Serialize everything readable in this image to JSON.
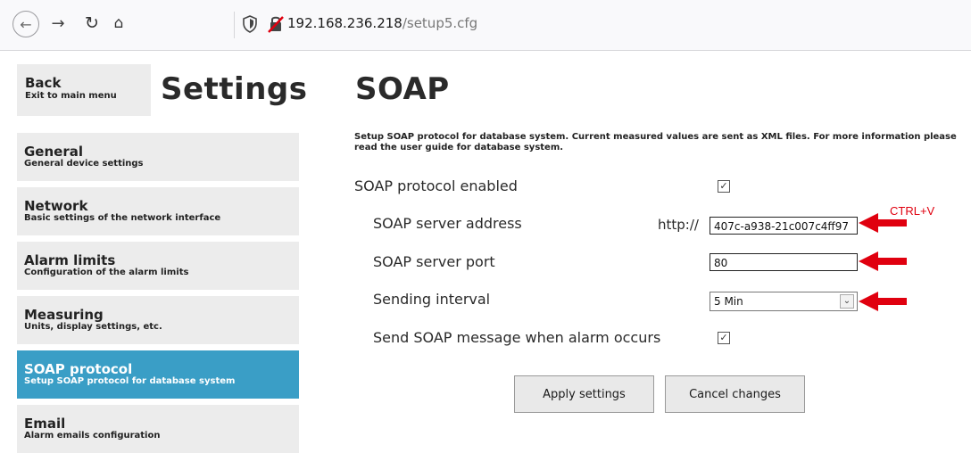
{
  "browser": {
    "url_host": "192.168.236.218",
    "url_path": "/setup5.cfg"
  },
  "sidebar": {
    "back": {
      "title": "Back",
      "subtitle": "Exit to main menu"
    },
    "heading": "Settings",
    "items": [
      {
        "title": "General",
        "subtitle": "General device settings"
      },
      {
        "title": "Network",
        "subtitle": "Basic settings of the network interface"
      },
      {
        "title": "Alarm limits",
        "subtitle": "Configuration of the alarm limits"
      },
      {
        "title": "Measuring",
        "subtitle": "Units, display settings, etc."
      },
      {
        "title": "SOAP protocol",
        "subtitle": "Setup SOAP protocol for database system"
      },
      {
        "title": "Email",
        "subtitle": "Alarm emails configuration"
      }
    ],
    "active_index": 4
  },
  "main": {
    "title": "SOAP",
    "description": "Setup SOAP protocol for database system. Current measured values are sent as XML files. For more information please read the user guide for database system.",
    "fields": {
      "enabled_label": "SOAP protocol enabled",
      "enabled_checked": true,
      "server_address_label": "SOAP server address",
      "server_address_prefix": "http://",
      "server_address_value": "407c-a938-21c007c4ff97",
      "server_port_label": "SOAP server port",
      "server_port_value": "80",
      "interval_label": "Sending interval",
      "interval_value": "5 Min",
      "alarm_label": "Send SOAP message when alarm occurs",
      "alarm_checked": true
    },
    "buttons": {
      "apply": "Apply settings",
      "cancel": "Cancel changes"
    }
  },
  "annotation": {
    "text": "CTRL+V",
    "color": "#e0000f"
  },
  "colors": {
    "active_menu": "#3a9ec6",
    "menu_bg": "#ececec"
  }
}
